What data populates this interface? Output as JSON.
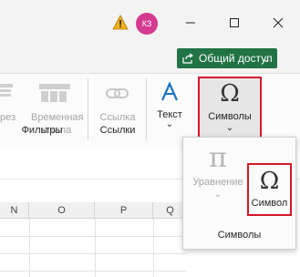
{
  "titlebar": {
    "avatar_initials": "КЗ"
  },
  "share": {
    "label": "Общий доступ",
    "caret": "⌄"
  },
  "ribbon": {
    "filters": {
      "partial_label": "рез",
      "timeline_label_line1": "Временная",
      "timeline_label_line2": "шкала",
      "group_label": "Фильтры"
    },
    "links": {
      "link_label": "Ссылка",
      "group_label": "Ссылки"
    },
    "text": {
      "label": "Текст",
      "caret": "⌄"
    },
    "symbols": {
      "label": "Символы",
      "caret": "⌄",
      "glyph": "Ω"
    },
    "collapse_caret": "⌄"
  },
  "popup": {
    "equation_label": "Уравнение",
    "equation_caret": "⌄",
    "equation_glyph": "π",
    "symbol_label": "Символ",
    "symbol_glyph": "Ω",
    "group_label": "Символы"
  },
  "grid": {
    "columns": [
      "N",
      "O",
      "P",
      "Q"
    ]
  },
  "colors": {
    "accent_green": "#217346",
    "highlight_red": "#d6162a",
    "avatar_pink": "#d43a8f",
    "warning_yellow": "#f2b01e",
    "text_blue": "#1a73c8"
  }
}
